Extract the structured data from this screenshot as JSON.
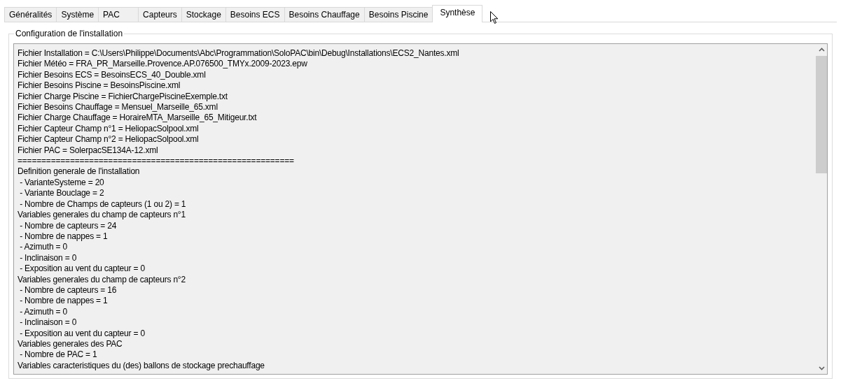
{
  "tabs": [
    {
      "label": "Généralités",
      "selected": false
    },
    {
      "label": "Système",
      "selected": false
    },
    {
      "label": "PAC",
      "selected": false
    },
    {
      "label": "Capteurs",
      "selected": false
    },
    {
      "label": "Stockage",
      "selected": false
    },
    {
      "label": "Besoins ECS",
      "selected": false
    },
    {
      "label": "Besoins Chauffage",
      "selected": false
    },
    {
      "label": "Besoins Piscine",
      "selected": false
    },
    {
      "label": "Synthèse",
      "selected": true
    }
  ],
  "group": {
    "title": "Configuration de l'installation",
    "lines": [
      "Fichier Installation = C:\\Users\\Philippe\\Documents\\Abc\\Programmation\\SoloPAC\\bin\\Debug\\Installations\\ECS2_Nantes.xml",
      "Fichier Météo = FRA_PR_Marseille.Provence.AP.076500_TMYx.2009-2023.epw",
      "Fichier Besoins ECS = BesoinsECS_40_Double.xml",
      "Fichier Besoins Piscine = BesoinsPiscine.xml",
      "Fichier Charge Piscine = FichierChargePiscineExemple.txt",
      "Fichier Besoins Chauffage = Mensuel_Marseille_65.xml",
      "Fichier Charge Chauffage = HoraireMTA_Marseille_65_Mitigeur.txt",
      "Fichier Capteur Champ n°1 = HeliopacSolpool.xml",
      "Fichier Capteur Champ n°2 = HeliopacSolpool.xml",
      "Fichier PAC = SolerpacSE134A-12.xml",
      "==========================================================",
      "Definition generale de l'installation",
      " - VarianteSysteme = 20",
      " - Variante Bouclage = 2",
      " - Nombre de Champs de capteurs (1 ou 2) = 1",
      "Variables generales du champ de capteurs n°1",
      " - Nombre de capteurs = 24",
      " - Nombre de nappes = 1",
      " - Azimuth = 0",
      " - Inclinaison = 0",
      " - Exposition au vent du capteur = 0",
      "Variables generales du champ de capteurs n°2",
      " - Nombre de capteurs = 16",
      " - Nombre de nappes = 1",
      " - Azimuth = 0",
      " - Inclinaison = 0",
      " - Exposition au vent du capteur = 0",
      "Variables generales des PAC",
      " - Nombre de PAC = 1",
      "Variables caracteristiques du (des) ballons de stockage prechauffage"
    ]
  }
}
